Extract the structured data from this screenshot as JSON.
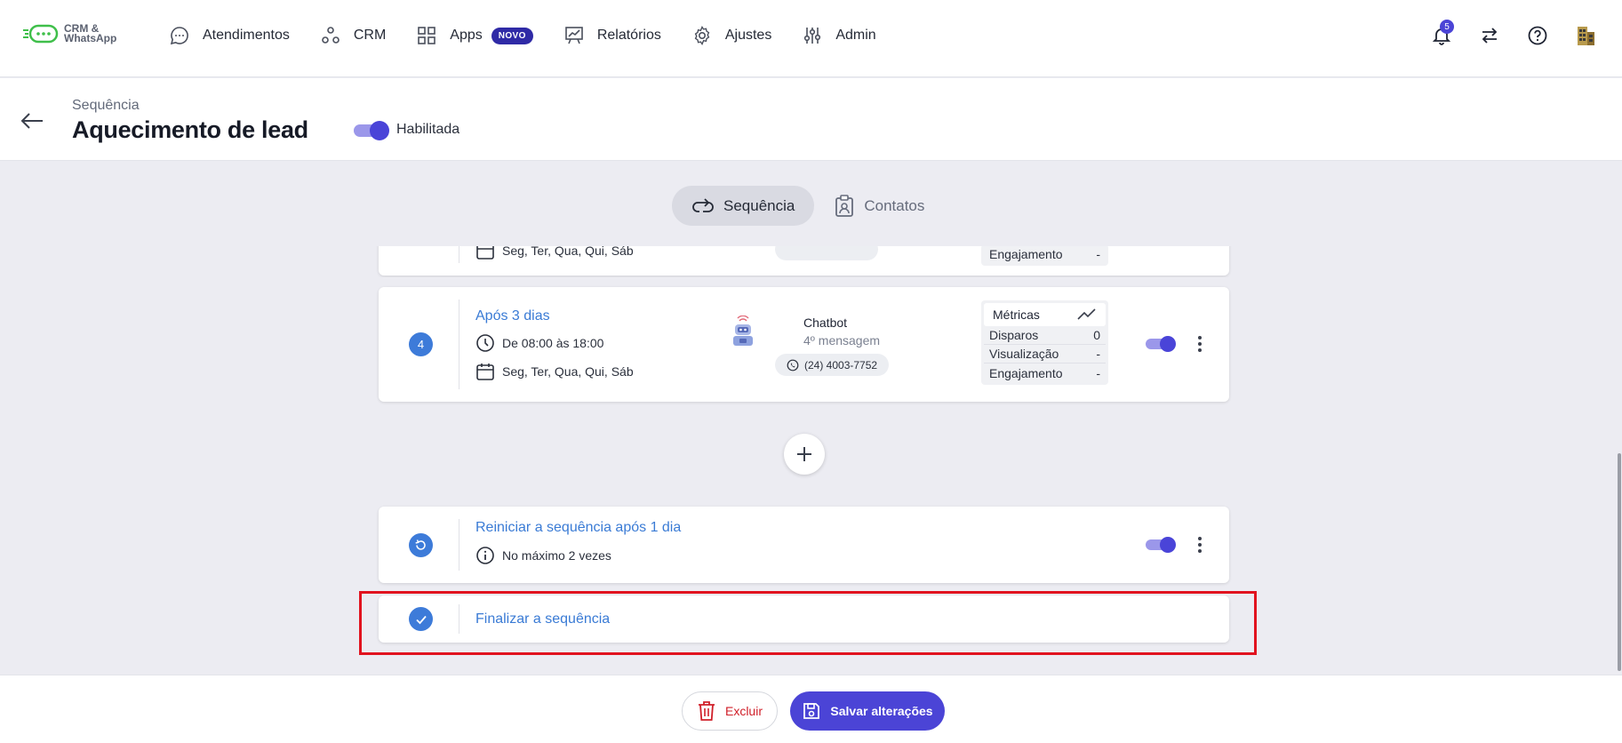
{
  "logo": {
    "line1": "CRM &",
    "line2": "WhatsApp"
  },
  "nav": {
    "items": [
      {
        "label": "Atendimentos",
        "icon": "chat-icon"
      },
      {
        "label": "CRM",
        "icon": "crm-icon"
      },
      {
        "label": "Apps",
        "icon": "grid-icon",
        "badge": "NOVO"
      },
      {
        "label": "Relatórios",
        "icon": "chart-icon"
      },
      {
        "label": "Ajustes",
        "icon": "gear-icon"
      },
      {
        "label": "Admin",
        "icon": "sliders-icon"
      }
    ],
    "notifications": "5"
  },
  "header": {
    "breadcrumb": "Sequência",
    "title": "Aquecimento de lead",
    "toggle_label": "Habilitada"
  },
  "tabs": [
    {
      "label": "Sequência",
      "active": true
    },
    {
      "label": "Contatos",
      "active": false
    }
  ],
  "partial_step": {
    "days": "Seg, Ter, Qua, Qui, Sáb",
    "metric_label": "Engajamento",
    "metric_value": "-"
  },
  "step4": {
    "number": "4",
    "title": "Após 3 dias",
    "hours": "De 08:00 às 18:00",
    "days": "Seg, Ter, Qua, Qui, Sáb",
    "channel": "Chatbot",
    "message": "4º mensagem",
    "phone": "(24) 4003-7752",
    "metrics_title": "Métricas",
    "metrics": [
      {
        "label": "Disparos",
        "value": "0"
      },
      {
        "label": "Visualização",
        "value": "-"
      },
      {
        "label": "Engajamento",
        "value": "-"
      }
    ]
  },
  "restart": {
    "title": "Reiniciar a sequência após 1 dia",
    "note": "No máximo 2 vezes"
  },
  "finish": {
    "title": "Finalizar a sequência"
  },
  "footer": {
    "delete_label": "Excluir",
    "save_label": "Salvar alterações"
  },
  "colors": {
    "accent": "#4b44d6",
    "link": "#3a7bd5",
    "danger": "#d0202a",
    "highlight": "#e1131f"
  }
}
